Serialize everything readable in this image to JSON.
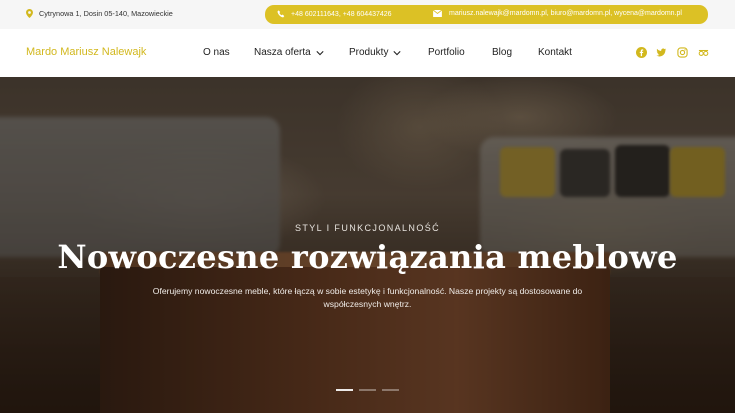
{
  "topbar": {
    "address": "Cytrynowa 1, Dosin 05-140, Mazowieckie",
    "phones": "+48 602111643, +48 604437426",
    "emails": "mariusz.nalewajk@mardomn.pl, biuro@mardomn.pl, wycena@mardomn.pl"
  },
  "nav": {
    "brand": "Mardo Mariusz Nalewajk",
    "items": [
      {
        "label": "O nas"
      },
      {
        "label": "Nasza oferta",
        "has_dropdown": true
      },
      {
        "label": "Produkty",
        "has_dropdown": true
      },
      {
        "label": "Portfolio"
      },
      {
        "label": "Blog"
      },
      {
        "label": "Kontakt"
      }
    ],
    "social": [
      "facebook-icon",
      "twitter-icon",
      "instagram-icon",
      "tripadvisor-icon"
    ]
  },
  "hero": {
    "kicker": "STYL I FUNKCJONALNOŚĆ",
    "headline": "Nowoczesne rozwiązania meblowe",
    "description": "Oferujemy nowoczesne meble, które łączą w sobie estetykę i funkcjonalność. Nasze projekty są dostosowane do współczesnych wnętrz.",
    "slides": 3,
    "active_slide": 1
  },
  "colors": {
    "accent": "#dcc125",
    "brand": "#d2b81e"
  }
}
